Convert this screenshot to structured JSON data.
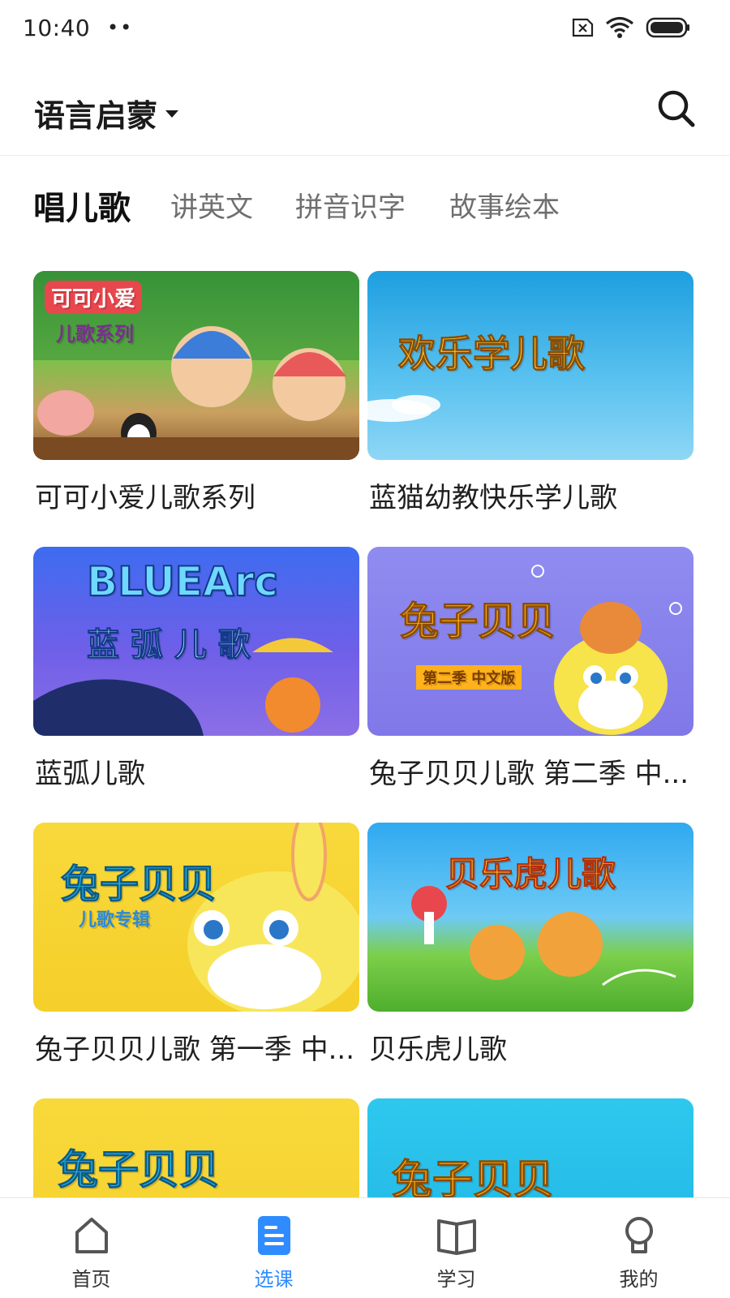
{
  "status_bar": {
    "time": "10:40",
    "dots": "••"
  },
  "header": {
    "title": "语言启蒙"
  },
  "tabs": [
    {
      "label": "唱儿歌",
      "active": true
    },
    {
      "label": "讲英文",
      "active": false
    },
    {
      "label": "拼音识字",
      "active": false
    },
    {
      "label": "故事绘本",
      "active": false
    }
  ],
  "cards": [
    {
      "title": "可可小爱儿歌系列",
      "thumb_text": "可可小爱",
      "thumb_sub": "儿歌系列"
    },
    {
      "title": "蓝猫幼教快乐学儿歌",
      "thumb_text": "欢乐学儿歌",
      "thumb_sub": ""
    },
    {
      "title": "蓝弧儿歌",
      "thumb_text": "BLUEArc",
      "thumb_sub": "蓝 弧 儿 歌"
    },
    {
      "title": "兔子贝贝儿歌 第二季 中...",
      "thumb_text": "兔子贝贝",
      "thumb_sub": "第二季 中文版"
    },
    {
      "title": "兔子贝贝儿歌 第一季 中...",
      "thumb_text": "兔子贝贝",
      "thumb_sub": "儿歌专辑"
    },
    {
      "title": "贝乐虎儿歌",
      "thumb_text": "贝乐虎儿歌",
      "thumb_sub": ""
    },
    {
      "title": "",
      "thumb_text": "兔子贝贝",
      "thumb_sub": ""
    },
    {
      "title": "",
      "thumb_text": "兔子贝贝",
      "thumb_sub": ""
    }
  ],
  "bottom_nav": [
    {
      "label": "首页",
      "icon": "home-icon",
      "active": false
    },
    {
      "label": "选课",
      "icon": "course-list-icon",
      "active": true
    },
    {
      "label": "学习",
      "icon": "book-icon",
      "active": false
    },
    {
      "label": "我的",
      "icon": "profile-icon",
      "active": false
    }
  ],
  "colors": {
    "accent": "#2f8cff",
    "text_primary": "#1a1a1a",
    "text_secondary": "#6f6f6f"
  }
}
